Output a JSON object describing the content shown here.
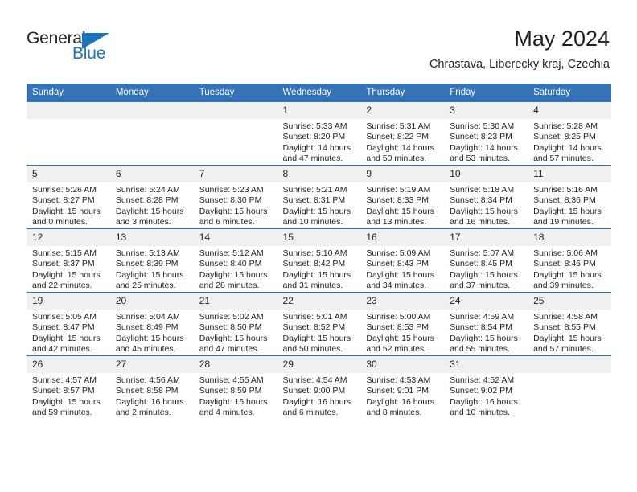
{
  "logo": {
    "word_general": "General",
    "word_blue": "Blue",
    "brand_color": "#1b75bc"
  },
  "header": {
    "title": "May 2024",
    "subtitle": "Chrastava, Liberecky kraj, Czechia",
    "header_bg_color": "#3573b9"
  },
  "calendar": {
    "weekday_headers": [
      "Sunday",
      "Monday",
      "Tuesday",
      "Wednesday",
      "Thursday",
      "Friday",
      "Saturday"
    ],
    "labels": {
      "sunrise": "Sunrise:",
      "sunset": "Sunset:",
      "daylight": "Daylight:"
    },
    "weeks": [
      [
        {
          "day": "",
          "empty": true
        },
        {
          "day": "",
          "empty": true
        },
        {
          "day": "",
          "empty": true
        },
        {
          "day": "1",
          "sunrise": "Sunrise: 5:33 AM",
          "sunset": "Sunset: 8:20 PM",
          "daylight_line1": "Daylight: 14 hours",
          "daylight_line2": "and 47 minutes."
        },
        {
          "day": "2",
          "sunrise": "Sunrise: 5:31 AM",
          "sunset": "Sunset: 8:22 PM",
          "daylight_line1": "Daylight: 14 hours",
          "daylight_line2": "and 50 minutes."
        },
        {
          "day": "3",
          "sunrise": "Sunrise: 5:30 AM",
          "sunset": "Sunset: 8:23 PM",
          "daylight_line1": "Daylight: 14 hours",
          "daylight_line2": "and 53 minutes."
        },
        {
          "day": "4",
          "sunrise": "Sunrise: 5:28 AM",
          "sunset": "Sunset: 8:25 PM",
          "daylight_line1": "Daylight: 14 hours",
          "daylight_line2": "and 57 minutes."
        }
      ],
      [
        {
          "day": "5",
          "sunrise": "Sunrise: 5:26 AM",
          "sunset": "Sunset: 8:27 PM",
          "daylight_line1": "Daylight: 15 hours",
          "daylight_line2": "and 0 minutes."
        },
        {
          "day": "6",
          "sunrise": "Sunrise: 5:24 AM",
          "sunset": "Sunset: 8:28 PM",
          "daylight_line1": "Daylight: 15 hours",
          "daylight_line2": "and 3 minutes."
        },
        {
          "day": "7",
          "sunrise": "Sunrise: 5:23 AM",
          "sunset": "Sunset: 8:30 PM",
          "daylight_line1": "Daylight: 15 hours",
          "daylight_line2": "and 6 minutes."
        },
        {
          "day": "8",
          "sunrise": "Sunrise: 5:21 AM",
          "sunset": "Sunset: 8:31 PM",
          "daylight_line1": "Daylight: 15 hours",
          "daylight_line2": "and 10 minutes."
        },
        {
          "day": "9",
          "sunrise": "Sunrise: 5:19 AM",
          "sunset": "Sunset: 8:33 PM",
          "daylight_line1": "Daylight: 15 hours",
          "daylight_line2": "and 13 minutes."
        },
        {
          "day": "10",
          "sunrise": "Sunrise: 5:18 AM",
          "sunset": "Sunset: 8:34 PM",
          "daylight_line1": "Daylight: 15 hours",
          "daylight_line2": "and 16 minutes."
        },
        {
          "day": "11",
          "sunrise": "Sunrise: 5:16 AM",
          "sunset": "Sunset: 8:36 PM",
          "daylight_line1": "Daylight: 15 hours",
          "daylight_line2": "and 19 minutes."
        }
      ],
      [
        {
          "day": "12",
          "sunrise": "Sunrise: 5:15 AM",
          "sunset": "Sunset: 8:37 PM",
          "daylight_line1": "Daylight: 15 hours",
          "daylight_line2": "and 22 minutes."
        },
        {
          "day": "13",
          "sunrise": "Sunrise: 5:13 AM",
          "sunset": "Sunset: 8:39 PM",
          "daylight_line1": "Daylight: 15 hours",
          "daylight_line2": "and 25 minutes."
        },
        {
          "day": "14",
          "sunrise": "Sunrise: 5:12 AM",
          "sunset": "Sunset: 8:40 PM",
          "daylight_line1": "Daylight: 15 hours",
          "daylight_line2": "and 28 minutes."
        },
        {
          "day": "15",
          "sunrise": "Sunrise: 5:10 AM",
          "sunset": "Sunset: 8:42 PM",
          "daylight_line1": "Daylight: 15 hours",
          "daylight_line2": "and 31 minutes."
        },
        {
          "day": "16",
          "sunrise": "Sunrise: 5:09 AM",
          "sunset": "Sunset: 8:43 PM",
          "daylight_line1": "Daylight: 15 hours",
          "daylight_line2": "and 34 minutes."
        },
        {
          "day": "17",
          "sunrise": "Sunrise: 5:07 AM",
          "sunset": "Sunset: 8:45 PM",
          "daylight_line1": "Daylight: 15 hours",
          "daylight_line2": "and 37 minutes."
        },
        {
          "day": "18",
          "sunrise": "Sunrise: 5:06 AM",
          "sunset": "Sunset: 8:46 PM",
          "daylight_line1": "Daylight: 15 hours",
          "daylight_line2": "and 39 minutes."
        }
      ],
      [
        {
          "day": "19",
          "sunrise": "Sunrise: 5:05 AM",
          "sunset": "Sunset: 8:47 PM",
          "daylight_line1": "Daylight: 15 hours",
          "daylight_line2": "and 42 minutes."
        },
        {
          "day": "20",
          "sunrise": "Sunrise: 5:04 AM",
          "sunset": "Sunset: 8:49 PM",
          "daylight_line1": "Daylight: 15 hours",
          "daylight_line2": "and 45 minutes."
        },
        {
          "day": "21",
          "sunrise": "Sunrise: 5:02 AM",
          "sunset": "Sunset: 8:50 PM",
          "daylight_line1": "Daylight: 15 hours",
          "daylight_line2": "and 47 minutes."
        },
        {
          "day": "22",
          "sunrise": "Sunrise: 5:01 AM",
          "sunset": "Sunset: 8:52 PM",
          "daylight_line1": "Daylight: 15 hours",
          "daylight_line2": "and 50 minutes."
        },
        {
          "day": "23",
          "sunrise": "Sunrise: 5:00 AM",
          "sunset": "Sunset: 8:53 PM",
          "daylight_line1": "Daylight: 15 hours",
          "daylight_line2": "and 52 minutes."
        },
        {
          "day": "24",
          "sunrise": "Sunrise: 4:59 AM",
          "sunset": "Sunset: 8:54 PM",
          "daylight_line1": "Daylight: 15 hours",
          "daylight_line2": "and 55 minutes."
        },
        {
          "day": "25",
          "sunrise": "Sunrise: 4:58 AM",
          "sunset": "Sunset: 8:55 PM",
          "daylight_line1": "Daylight: 15 hours",
          "daylight_line2": "and 57 minutes."
        }
      ],
      [
        {
          "day": "26",
          "sunrise": "Sunrise: 4:57 AM",
          "sunset": "Sunset: 8:57 PM",
          "daylight_line1": "Daylight: 15 hours",
          "daylight_line2": "and 59 minutes."
        },
        {
          "day": "27",
          "sunrise": "Sunrise: 4:56 AM",
          "sunset": "Sunset: 8:58 PM",
          "daylight_line1": "Daylight: 16 hours",
          "daylight_line2": "and 2 minutes."
        },
        {
          "day": "28",
          "sunrise": "Sunrise: 4:55 AM",
          "sunset": "Sunset: 8:59 PM",
          "daylight_line1": "Daylight: 16 hours",
          "daylight_line2": "and 4 minutes."
        },
        {
          "day": "29",
          "sunrise": "Sunrise: 4:54 AM",
          "sunset": "Sunset: 9:00 PM",
          "daylight_line1": "Daylight: 16 hours",
          "daylight_line2": "and 6 minutes."
        },
        {
          "day": "30",
          "sunrise": "Sunrise: 4:53 AM",
          "sunset": "Sunset: 9:01 PM",
          "daylight_line1": "Daylight: 16 hours",
          "daylight_line2": "and 8 minutes."
        },
        {
          "day": "31",
          "sunrise": "Sunrise: 4:52 AM",
          "sunset": "Sunset: 9:02 PM",
          "daylight_line1": "Daylight: 16 hours",
          "daylight_line2": "and 10 minutes."
        },
        {
          "day": "",
          "empty": true
        }
      ]
    ]
  }
}
